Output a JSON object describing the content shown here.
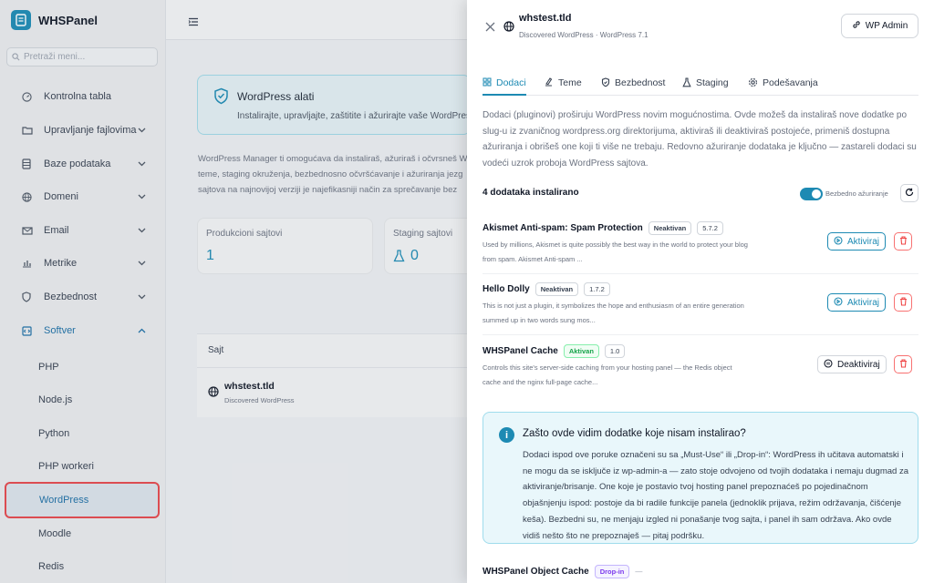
{
  "app": {
    "brand": "WHSPanel"
  },
  "sidebar": {
    "search_placeholder": "Pretraži meni...",
    "items": [
      {
        "label": "Kontrolna tabla"
      },
      {
        "label": "Upravljanje fajlovima"
      },
      {
        "label": "Baze podataka"
      },
      {
        "label": "Domeni"
      },
      {
        "label": "Email"
      },
      {
        "label": "Metrike"
      },
      {
        "label": "Bezbednost"
      },
      {
        "label": "Softver"
      }
    ],
    "sub_items": [
      {
        "label": "PHP"
      },
      {
        "label": "Node.js"
      },
      {
        "label": "Python"
      },
      {
        "label": "PHP workeri"
      },
      {
        "label": "WordPress"
      },
      {
        "label": "Moodle"
      },
      {
        "label": "Redis"
      }
    ]
  },
  "background": {
    "banner_title": "WordPress alati",
    "banner_text": "Instalirajte, upravljajte, zaštitite i ažurirajte vaše WordPress",
    "intro_lines": [
      "WordPress Manager ti omogućava da instaliraš, ažuriraš i očvrsneš W",
      "teme, staging okruženja, bezbednosno očvršćavanje i ažuriranja jezg",
      "sajtova na najnovijoj verziji je najefikasniji način za sprečavanje bez"
    ],
    "stats": [
      {
        "label": "Produkcioni sajtovi",
        "value": "1"
      },
      {
        "label": "Staging sajtovi",
        "value": "0"
      }
    ],
    "table_header": "Sajt",
    "row_title": "whstest.tld",
    "row_sub": "Discovered WordPress"
  },
  "panel": {
    "site_name": "whstest.tld",
    "site_meta": "Discovered WordPress · WordPress 7.1",
    "wp_admin_label": "WP Admin",
    "tabs": [
      {
        "label": "Dodaci"
      },
      {
        "label": "Teme"
      },
      {
        "label": "Bezbednost"
      },
      {
        "label": "Staging"
      },
      {
        "label": "Podešavanja"
      }
    ],
    "description": "Dodaci (pluginovi) proširuju WordPress novim mogućnostima. Ovde možeš da instaliraš nove dodatke po slug-u iz zvaničnog wordpress.org direktorijuma, aktiviraš ili deaktiviraš postojeće, primeniš dostupna ažuriranja i obrišeš one koji ti više ne trebaju. Redovno ažuriranje dodataka je ključno — zastareli dodaci su vodeći uzrok proboja WordPress sajtova.",
    "installed_count": "4 dodataka instalirano",
    "safe_update_label": "Bezbedno ažuriranje",
    "plugins": [
      {
        "name": "Akismet Anti-spam: Spam Protection",
        "status": "Neaktivan",
        "version": "5.7.2",
        "desc1": "Used by millions, Akismet is quite possibly the best way in the world to protect your blog",
        "desc2": "from spam. Akismet Anti-spam ...",
        "action": "Aktiviraj"
      },
      {
        "name": "Hello Dolly",
        "status": "Neaktivan",
        "version": "1.7.2",
        "desc1": "This is not just a plugin, it symbolizes the hope and enthusiasm of an entire generation",
        "desc2": "summed up in two words sung mos...",
        "action": "Aktiviraj"
      },
      {
        "name": "WHSPanel Cache",
        "status": "Aktivan",
        "version": "1.0",
        "desc1": "Controls this site's server-side caching from your hosting panel — the Redis object",
        "desc2": "cache and the nginx full-page cache...",
        "action": "Deaktiviraj"
      }
    ],
    "notice_title": "Zašto ovde vidim dodatke koje nisam instalirao?",
    "notice_body": "Dodaci ispod ove poruke označeni su sa „Must-Use“ ili „Drop-in“: WordPress ih učitava automatski i ne mogu da se isključe iz wp-admin-a — zato stoje odvojeno od tvojih dodataka i nemaju dugmad za aktiviranje/brisanje. One koje je postavio tvoj hosting panel prepoznaćeš po pojedinačnom objašnjenju ispod: postoje da bi radile funkcije panela (jednoklik prijava, režim održavanja, čišćenje keša). Bezbedni su, ne menjaju izgled ni ponašanje tvog sajta, i panel ih sam održava. Ako ovde vidiš nešto što ne prepoznaješ — pitaj podršku.",
    "dropin_name": "WHSPanel Object Cache",
    "dropin_badge": "Drop-in",
    "dropin_version": "—"
  },
  "colors": {
    "accent": "#1d8ab3",
    "danger": "#e5484d",
    "success": "#16a34a",
    "dropin": "#7c3aed"
  }
}
